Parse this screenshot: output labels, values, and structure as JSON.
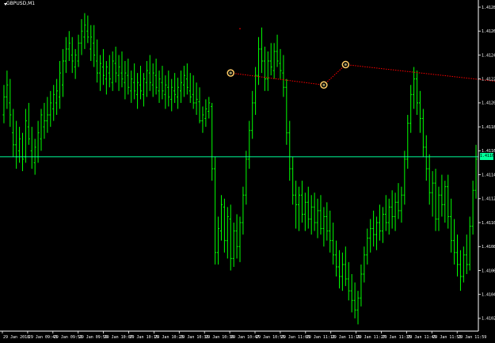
{
  "window": {
    "symbol_label": "GBPUSD,M1"
  },
  "colors": {
    "background": "#000000",
    "bars": "#00ff00",
    "axis": "#ffffff",
    "bid_line": "#00ff99",
    "trend_line": "#ff0000",
    "marker": "#ffcc66"
  },
  "bid_price": "1.41160",
  "price_axis": [
    "1.41285",
    "1.41265",
    "1.41245",
    "1.41225",
    "1.41205",
    "1.41185",
    "1.41165",
    "1.41145",
    "1.41125",
    "1.41105",
    "1.41085",
    "1.41065",
    "1.41045",
    "1.41025"
  ],
  "time_axis": [
    "29 Jan 2018",
    "29 Jan 09:43",
    "29 Jan 09:51",
    "29 Jan 09:59",
    "29 Jan 10:07",
    "29 Jan 10:15",
    "29 Jan 10:23",
    "29 Jan 10:31",
    "29 Jan 10:39",
    "29 Jan 10:47",
    "29 Jan 10:55",
    "29 Jan 11:03",
    "29 Jan 11:11",
    "29 Jan 11:19",
    "29 Jan 11:27",
    "29 Jan 11:35",
    "29 Jan 11:43",
    "29 Jan 11:51",
    "29 Jan 11:59"
  ],
  "chart_data": {
    "type": "ohlc",
    "price_range": [
      1.41017,
      1.41287
    ],
    "bars": [
      [
        1.41195,
        1.4122,
        1.41188,
        1.4121
      ],
      [
        1.4121,
        1.41232,
        1.412,
        1.4122
      ],
      [
        1.41205,
        1.41225,
        1.41185,
        1.41195
      ],
      [
        1.4118,
        1.412,
        1.4116,
        1.4117
      ],
      [
        1.4117,
        1.4119,
        1.4115,
        1.4116
      ],
      [
        1.41165,
        1.41185,
        1.41155,
        1.41175
      ],
      [
        1.4116,
        1.4118,
        1.41148,
        1.41158
      ],
      [
        1.4116,
        1.412,
        1.41155,
        1.4119
      ],
      [
        1.41185,
        1.41205,
        1.4117,
        1.41175
      ],
      [
        1.41165,
        1.41185,
        1.4115,
        1.4116
      ],
      [
        1.41155,
        1.41175,
        1.41145,
        1.41168
      ],
      [
        1.4116,
        1.4119,
        1.41155,
        1.4118
      ],
      [
        1.41175,
        1.412,
        1.41165,
        1.41195
      ],
      [
        1.41185,
        1.41205,
        1.41175,
        1.4119
      ],
      [
        1.4119,
        1.4121,
        1.4118,
        1.41195
      ],
      [
        1.41195,
        1.41215,
        1.41185,
        1.41205
      ],
      [
        1.412,
        1.4122,
        1.4119,
        1.41212
      ],
      [
        1.41205,
        1.41225,
        1.41195,
        1.41215
      ],
      [
        1.4121,
        1.4124,
        1.412,
        1.4123
      ],
      [
        1.4122,
        1.4125,
        1.4121,
        1.4124
      ],
      [
        1.4124,
        1.4126,
        1.4123,
        1.4125
      ],
      [
        1.4125,
        1.41265,
        1.4124,
        1.41255
      ],
      [
        1.41245,
        1.4126,
        1.4123,
        1.4124
      ],
      [
        1.41235,
        1.4125,
        1.41225,
        1.41245
      ],
      [
        1.4124,
        1.41262,
        1.41235,
        1.41255
      ],
      [
        1.41255,
        1.41275,
        1.41245,
        1.41265
      ],
      [
        1.4126,
        1.4128,
        1.4125,
        1.4127
      ],
      [
        1.41265,
        1.41278,
        1.41255,
        1.4126
      ],
      [
        1.4125,
        1.4127,
        1.4124,
        1.4126
      ],
      [
        1.41255,
        1.4127,
        1.41235,
        1.41245
      ],
      [
        1.4124,
        1.41258,
        1.41222,
        1.4123
      ],
      [
        1.4123,
        1.41245,
        1.41215,
        1.41238
      ],
      [
        1.41235,
        1.4125,
        1.4122,
        1.41228
      ],
      [
        1.41225,
        1.4124,
        1.41212,
        1.41235
      ],
      [
        1.4123,
        1.41245,
        1.41218,
        1.41225
      ],
      [
        1.41222,
        1.41248,
        1.41215,
        1.4124
      ],
      [
        1.41238,
        1.41252,
        1.41222,
        1.4123
      ],
      [
        1.41228,
        1.41245,
        1.41215,
        1.41235
      ],
      [
        1.4123,
        1.41248,
        1.41218,
        1.41225
      ],
      [
        1.41222,
        1.4124,
        1.41208,
        1.4123
      ],
      [
        1.41228,
        1.41242,
        1.41212,
        1.41218
      ],
      [
        1.41215,
        1.41232,
        1.41205,
        1.41225
      ],
      [
        1.41222,
        1.41238,
        1.41208,
        1.41215
      ],
      [
        1.41212,
        1.4123,
        1.412,
        1.41222
      ],
      [
        1.4122,
        1.41236,
        1.41208,
        1.41215
      ],
      [
        1.41212,
        1.4123,
        1.41202,
        1.41225
      ],
      [
        1.41222,
        1.4124,
        1.4121,
        1.41232
      ],
      [
        1.4123,
        1.41245,
        1.41215,
        1.41222
      ],
      [
        1.4122,
        1.41238,
        1.4121,
        1.4123
      ],
      [
        1.41228,
        1.41242,
        1.41212,
        1.41218
      ],
      [
        1.41215,
        1.41232,
        1.41205,
        1.41225
      ],
      [
        1.41222,
        1.41236,
        1.41208,
        1.41215
      ],
      [
        1.41212,
        1.41228,
        1.412,
        1.4122
      ],
      [
        1.41218,
        1.41232,
        1.41202,
        1.4121
      ],
      [
        1.41208,
        1.41225,
        1.41198,
        1.41218
      ],
      [
        1.41215,
        1.4123,
        1.41205,
        1.41212
      ],
      [
        1.4121,
        1.41226,
        1.412,
        1.41218
      ],
      [
        1.41215,
        1.41232,
        1.41205,
        1.41222
      ],
      [
        1.4122,
        1.41236,
        1.4121,
        1.41228
      ],
      [
        1.41225,
        1.41238,
        1.41212,
        1.41218
      ],
      [
        1.41215,
        1.4123,
        1.41205,
        1.4121
      ],
      [
        1.41212,
        1.41228,
        1.412,
        1.41205
      ],
      [
        1.41205,
        1.41222,
        1.41195,
        1.41208
      ],
      [
        1.41206,
        1.41218,
        1.41188,
        1.4119
      ],
      [
        1.4119,
        1.41202,
        1.4118,
        1.41195
      ],
      [
        1.41192,
        1.41208,
        1.41185,
        1.412
      ],
      [
        1.41198,
        1.4121,
        1.41192,
        1.41205
      ],
      [
        1.41202,
        1.41205,
        1.4114,
        1.4115
      ],
      [
        1.4115,
        1.4116,
        1.4107,
        1.4108
      ],
      [
        1.4108,
        1.4111,
        1.4107,
        1.411
      ],
      [
        1.41098,
        1.41128,
        1.4109,
        1.4112
      ],
      [
        1.41118,
        1.41125,
        1.4108,
        1.4109
      ],
      [
        1.4109,
        1.41118,
        1.41075,
        1.4111
      ],
      [
        1.41108,
        1.4112,
        1.41065,
        1.41075
      ],
      [
        1.41075,
        1.41105,
        1.41068,
        1.41098
      ],
      [
        1.41098,
        1.41112,
        1.41075,
        1.41085
      ],
      [
        1.41085,
        1.4111,
        1.41072,
        1.41105
      ],
      [
        1.41105,
        1.41135,
        1.41095,
        1.41128
      ],
      [
        1.41128,
        1.41165,
        1.4112,
        1.41158
      ],
      [
        1.41158,
        1.4119,
        1.4115,
        1.41182
      ],
      [
        1.41182,
        1.41215,
        1.41175,
        1.41205
      ],
      [
        1.41205,
        1.41235,
        1.41195,
        1.41228
      ],
      [
        1.41228,
        1.4126,
        1.4122,
        1.4125
      ],
      [
        1.4125,
        1.41268,
        1.4123,
        1.4124
      ],
      [
        1.4124,
        1.41252,
        1.41215,
        1.41225
      ],
      [
        1.41225,
        1.41248,
        1.41215,
        1.4124
      ],
      [
        1.4124,
        1.41255,
        1.41228,
        1.41235
      ],
      [
        1.41232,
        1.41255,
        1.41225,
        1.41248
      ],
      [
        1.41248,
        1.41262,
        1.41235,
        1.4124
      ],
      [
        1.41238,
        1.4125,
        1.41225,
        1.41232
      ],
      [
        1.4123,
        1.41245,
        1.4121,
        1.41218
      ],
      [
        1.41218,
        1.41225,
        1.4117,
        1.4118
      ],
      [
        1.4118,
        1.4119,
        1.4114,
        1.4115
      ],
      [
        1.4115,
        1.4116,
        1.4112,
        1.41128
      ],
      [
        1.41128,
        1.4114,
        1.411,
        1.4112
      ],
      [
        1.4112,
        1.41135,
        1.41098,
        1.41128
      ],
      [
        1.41128,
        1.4114,
        1.41105,
        1.41112
      ],
      [
        1.41112,
        1.4113,
        1.41098,
        1.41122
      ],
      [
        1.41122,
        1.41135,
        1.411,
        1.41108
      ],
      [
        1.41108,
        1.41128,
        1.41095,
        1.41118
      ],
      [
        1.41118,
        1.4113,
        1.41098,
        1.41105
      ],
      [
        1.41105,
        1.41125,
        1.41092,
        1.41115
      ],
      [
        1.41115,
        1.41128,
        1.41095,
        1.411
      ],
      [
        1.411,
        1.41118,
        1.41085,
        1.4111
      ],
      [
        1.4111,
        1.41122,
        1.4109,
        1.41098
      ],
      [
        1.41098,
        1.41115,
        1.4108,
        1.4109
      ],
      [
        1.4109,
        1.41105,
        1.4107,
        1.41078
      ],
      [
        1.41078,
        1.4109,
        1.4106,
        1.41068
      ],
      [
        1.41068,
        1.41082,
        1.4105,
        1.4106
      ],
      [
        1.4106,
        1.4108,
        1.41048,
        1.4107
      ],
      [
        1.4107,
        1.41085,
        1.41052,
        1.41058
      ],
      [
        1.41058,
        1.41072,
        1.4104,
        1.41048
      ],
      [
        1.41048,
        1.41062,
        1.4103,
        1.4104
      ],
      [
        1.4104,
        1.41055,
        1.41025,
        1.41032
      ],
      [
        1.41032,
        1.41048,
        1.4102,
        1.41042
      ],
      [
        1.41042,
        1.4107,
        1.41035,
        1.41062
      ],
      [
        1.41062,
        1.41085,
        1.41055,
        1.41078
      ],
      [
        1.41078,
        1.411,
        1.4107,
        1.41092
      ],
      [
        1.41092,
        1.41108,
        1.4108,
        1.411
      ],
      [
        1.411,
        1.41115,
        1.41085,
        1.41095
      ],
      [
        1.41095,
        1.4111,
        1.41082,
        1.41105
      ],
      [
        1.41105,
        1.4112,
        1.4109,
        1.41098
      ],
      [
        1.41098,
        1.41118,
        1.41088,
        1.41112
      ],
      [
        1.41112,
        1.41128,
        1.41098,
        1.41105
      ],
      [
        1.41105,
        1.41125,
        1.41095,
        1.41118
      ],
      [
        1.41118,
        1.41132,
        1.411,
        1.4111
      ],
      [
        1.4111,
        1.4113,
        1.41098,
        1.41122
      ],
      [
        1.41122,
        1.41138,
        1.41108,
        1.41115
      ],
      [
        1.41115,
        1.41135,
        1.41105,
        1.41128
      ],
      [
        1.41128,
        1.41165,
        1.4112,
        1.41158
      ],
      [
        1.41158,
        1.41195,
        1.4115,
        1.41188
      ],
      [
        1.41188,
        1.4122,
        1.4118,
        1.41212
      ],
      [
        1.41212,
        1.41235,
        1.412,
        1.41225
      ],
      [
        1.41225,
        1.41232,
        1.41195,
        1.41205
      ],
      [
        1.41205,
        1.41215,
        1.4118,
        1.41192
      ],
      [
        1.41192,
        1.412,
        1.4116,
        1.41168
      ],
      [
        1.41168,
        1.41178,
        1.4114,
        1.4115
      ],
      [
        1.4115,
        1.41162,
        1.4112,
        1.4113
      ],
      [
        1.4113,
        1.41148,
        1.4111,
        1.41138
      ],
      [
        1.41138,
        1.4115,
        1.41098,
        1.41108
      ],
      [
        1.41108,
        1.41135,
        1.41098,
        1.41128
      ],
      [
        1.41128,
        1.41145,
        1.4111,
        1.4112
      ],
      [
        1.4112,
        1.4114,
        1.41105,
        1.41135
      ],
      [
        1.41135,
        1.41145,
        1.411,
        1.4111
      ],
      [
        1.4111,
        1.41125,
        1.4108,
        1.4109
      ],
      [
        1.4109,
        1.41108,
        1.4107,
        1.4108
      ],
      [
        1.4108,
        1.41095,
        1.4106,
        1.4107
      ],
      [
        1.4107,
        1.41082,
        1.41048,
        1.4106
      ],
      [
        1.4106,
        1.41085,
        1.41055,
        1.41078
      ],
      [
        1.41078,
        1.41095,
        1.41062,
        1.4107
      ],
      [
        1.4107,
        1.4111,
        1.41065,
        1.41102
      ],
      [
        1.41102,
        1.4114,
        1.41095,
        1.41132
      ],
      [
        1.41132,
        1.4117,
        1.41125,
        1.41158
      ]
    ],
    "bid_level": 1.4116,
    "trend_line": {
      "color": "#ff0000",
      "style": "dotted",
      "points": [
        [
          73,
          1.4123
        ],
        [
          103,
          1.4122
        ],
        [
          110,
          1.41237
        ],
        [
          162,
          1.41222
        ]
      ]
    },
    "markers": [
      {
        "bar": 73,
        "price": 1.4123
      },
      {
        "bar": 103,
        "price": 1.4122
      },
      {
        "bar": 110,
        "price": 1.41237
      },
      {
        "bar": 162,
        "price": 1.41222
      }
    ],
    "stray_point": {
      "bar": 76,
      "price": 1.41267
    }
  }
}
